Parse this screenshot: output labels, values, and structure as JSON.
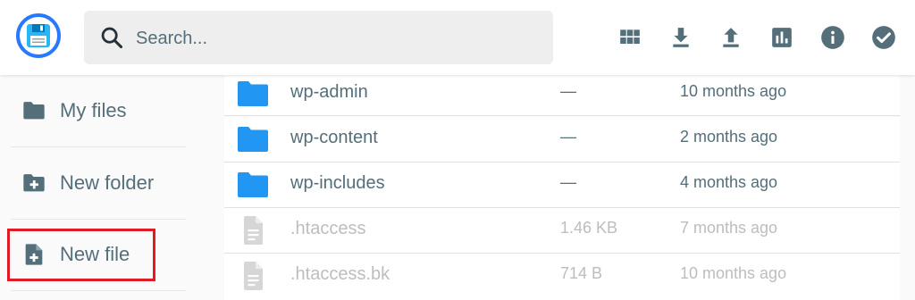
{
  "search": {
    "placeholder": "Search..."
  },
  "header": {
    "actions": [
      {
        "icon": "grid-view-icon"
      },
      {
        "icon": "download-icon"
      },
      {
        "icon": "upload-icon"
      },
      {
        "icon": "chart-icon"
      },
      {
        "icon": "info-icon"
      },
      {
        "icon": "check-circle-icon"
      }
    ]
  },
  "sidebar": {
    "items": [
      {
        "label": "My files",
        "icon": "folder-icon"
      },
      {
        "label": "New folder",
        "icon": "folder-add-icon"
      },
      {
        "label": "New file",
        "icon": "file-add-icon"
      }
    ]
  },
  "files": [
    {
      "name": "wp-admin",
      "size": "—",
      "modified": "10 months ago",
      "type": "folder"
    },
    {
      "name": "wp-content",
      "size": "—",
      "modified": "2 months ago",
      "type": "folder"
    },
    {
      "name": "wp-includes",
      "size": "—",
      "modified": "4 months ago",
      "type": "folder"
    },
    {
      "name": ".htaccess",
      "size": "1.46 KB",
      "modified": "7 months ago",
      "type": "file"
    },
    {
      "name": ".htaccess.bk",
      "size": "714 B",
      "modified": "10 months ago",
      "type": "file"
    }
  ],
  "colors": {
    "accent": "#2979ff",
    "folder": "#2196f3",
    "icon": "#546e7a",
    "highlight": "#e01b24"
  }
}
